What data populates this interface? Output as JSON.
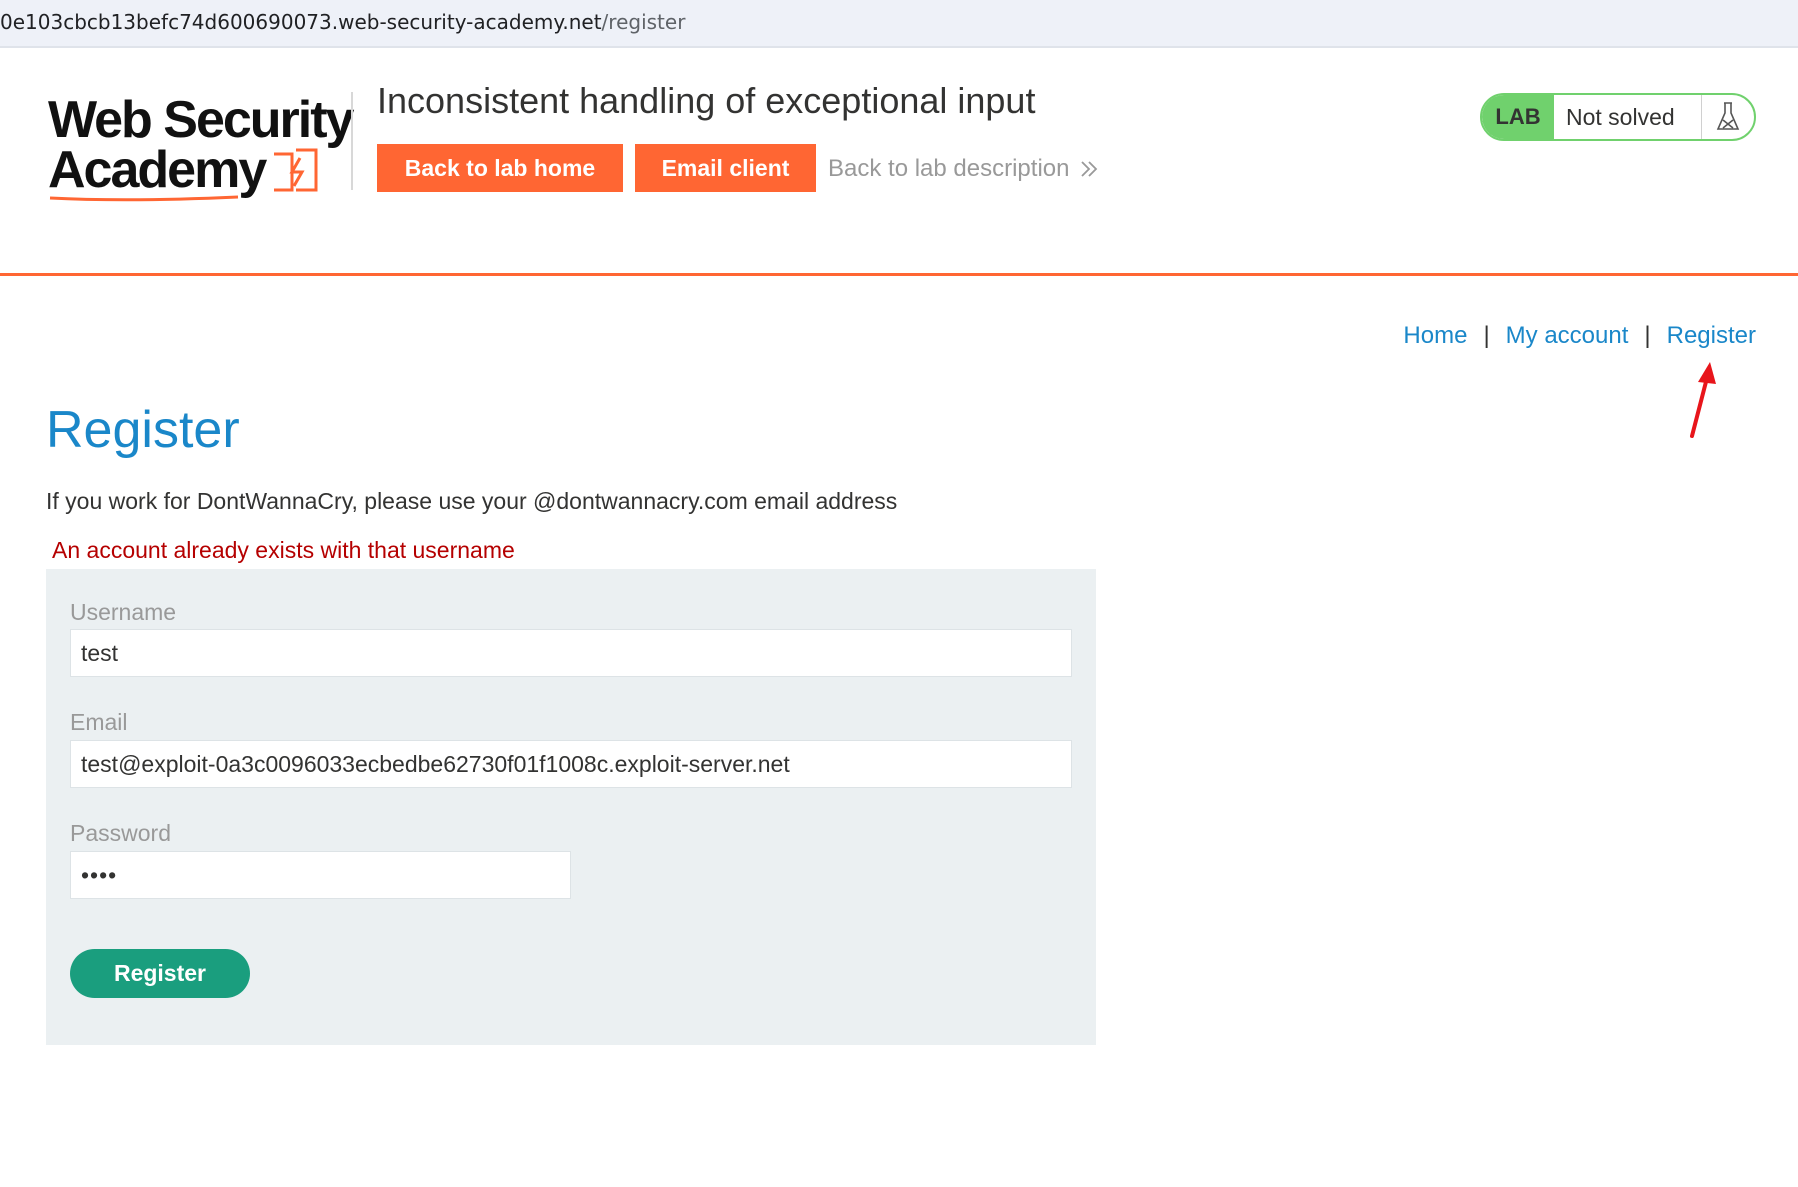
{
  "browser": {
    "url_host": "0e103cbcb13befc74d600690073.web-security-academy.net",
    "url_path": "/register"
  },
  "header": {
    "logo": {
      "line1": "Web Security",
      "line2": "Academy"
    },
    "lab_title": "Inconsistent handling of exceptional input",
    "back_to_lab_home": "Back to lab home",
    "email_client": "Email client",
    "back_to_lab_description": "Back to lab description",
    "lab_badge": "LAB",
    "lab_status": "Not solved"
  },
  "nav": {
    "home": "Home",
    "separator": "|",
    "my_account": "My account",
    "register": "Register"
  },
  "main": {
    "title": "Register",
    "info": "If you work for DontWannaCry, please use your @dontwannacry.com email address",
    "error": "An account already exists with that username",
    "form": {
      "username_label": "Username",
      "username_value": "test",
      "email_label": "Email",
      "email_value": "test@exploit-0a3c0096033ecbedbe62730f01f1008c.exploit-server.net",
      "password_label": "Password",
      "password_value": "••••",
      "submit_label": "Register"
    }
  },
  "colors": {
    "accent_orange": "#ff6633",
    "link_blue": "#1a87c9",
    "lab_green": "#70d16d",
    "register_button": "#1a9e7e",
    "error_red": "#b50000",
    "annotation_arrow": "#e8151b"
  },
  "icons": {
    "flask": "flask-icon",
    "chevrons": "double-chevron-right-icon",
    "annotation": "red-arrow-annotation"
  }
}
